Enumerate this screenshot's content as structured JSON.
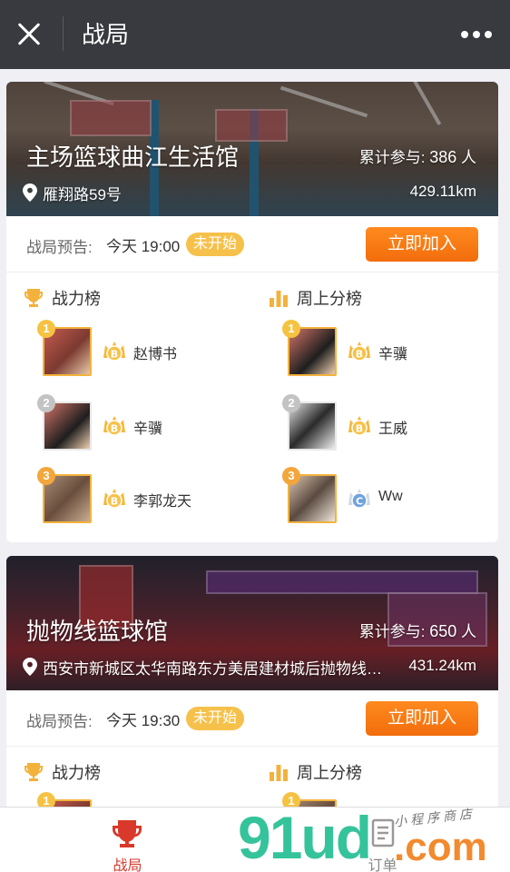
{
  "topbar": {
    "title": "战局"
  },
  "venues": [
    {
      "name": "主场篮球曲江生活馆",
      "total_label": "累计参与:",
      "total_count": "386",
      "total_unit": "人",
      "address": "雁翔路59号",
      "distance": "429.11km",
      "preview_label": "战局预告:",
      "preview_time": "今天 19:00",
      "status": "未开始",
      "join_label": "立即加入",
      "boards": {
        "power": {
          "title": "战力榜",
          "items": [
            {
              "rank": "1",
              "name": "赵博书",
              "badge": "B"
            },
            {
              "rank": "2",
              "name": "辛骥",
              "badge": "B"
            },
            {
              "rank": "3",
              "name": "李郭龙天",
              "badge": "B"
            }
          ]
        },
        "weekly": {
          "title": "周上分榜",
          "items": [
            {
              "rank": "1",
              "name": "辛骥",
              "badge": "B"
            },
            {
              "rank": "2",
              "name": "王威",
              "badge": "B"
            },
            {
              "rank": "3",
              "name": "Ww",
              "badge": "C"
            }
          ]
        }
      }
    },
    {
      "name": "抛物线篮球馆",
      "total_label": "累计参与:",
      "total_count": "650",
      "total_unit": "人",
      "address": "西安市新城区太华南路东方美居建材城后抛物线…",
      "distance": "431.24km",
      "preview_label": "战局预告:",
      "preview_time": "今天 19:30",
      "status": "未开始",
      "join_label": "立即加入",
      "boards": {
        "power": {
          "title": "战力榜",
          "items": [
            {
              "rank": "1"
            }
          ]
        },
        "weekly": {
          "title": "周上分榜",
          "items": [
            {
              "rank": "1"
            }
          ]
        }
      }
    }
  ],
  "tabbar": {
    "items": [
      {
        "label": "战局",
        "icon": "trophy-icon",
        "active": true
      },
      {
        "label": "订单",
        "icon": "order-icon",
        "active": false
      }
    ]
  },
  "watermark": {
    "main": "91ud",
    "suffix": ".com",
    "sub": "小程序商店"
  },
  "colors": {
    "accent": "#f26d0c",
    "status": "#f6c14b",
    "tab_active": "#d9392b",
    "topbar": "#393a3f"
  }
}
